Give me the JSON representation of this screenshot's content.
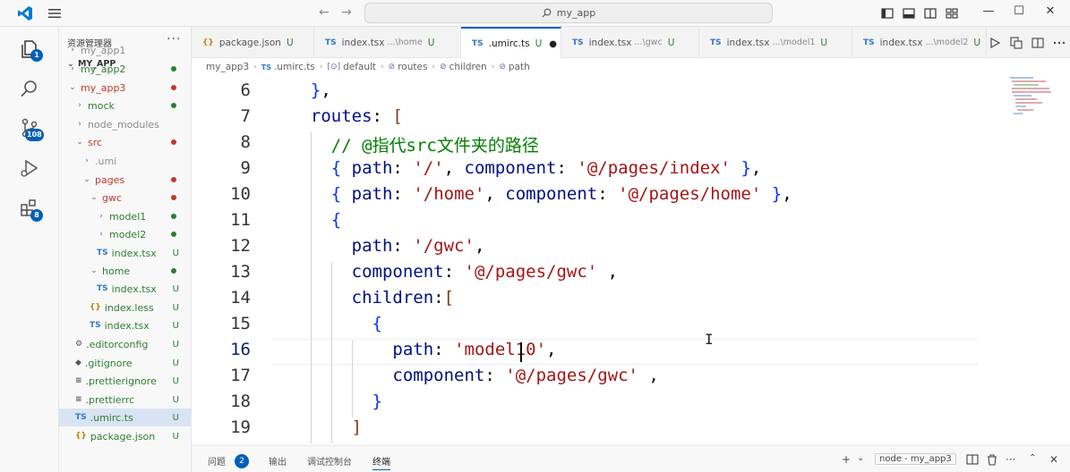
{
  "titlebar": {
    "search_text": "my_app",
    "back_icon": "arrow-left-icon",
    "forward_icon": "arrow-right-icon"
  },
  "activity": {
    "explorer_badge": "1",
    "scm_badge": "108",
    "extensions_badge": "8"
  },
  "sidebar": {
    "title": "资源管理器",
    "more": "···",
    "root_label": "MY_APP",
    "items": [
      {
        "label": "my_app1",
        "chevron": "›",
        "color": "grey",
        "status": ""
      },
      {
        "label": "my_app2",
        "chevron": "›",
        "color": "green",
        "status": "dot-green"
      },
      {
        "label": "my_app3",
        "chevron": "⌄",
        "color": "red",
        "status": "dot-red"
      },
      {
        "label": "mock",
        "chevron": "›",
        "color": "green",
        "status": "dot-green"
      },
      {
        "label": "node_modules",
        "chevron": "›",
        "color": "grey",
        "status": ""
      },
      {
        "label": "src",
        "chevron": "⌄",
        "color": "red",
        "status": "dot-red"
      },
      {
        "label": ".umi",
        "chevron": "›",
        "color": "grey",
        "status": ""
      },
      {
        "label": "pages",
        "chevron": "⌄",
        "color": "red",
        "status": "dot-red"
      },
      {
        "label": "gwc",
        "chevron": "⌄",
        "color": "red",
        "status": "dot-red"
      },
      {
        "label": "model1",
        "chevron": "›",
        "color": "green",
        "status": "dot-green"
      },
      {
        "label": "model2",
        "chevron": "›",
        "color": "green",
        "status": "dot-green"
      },
      {
        "label": "index.tsx",
        "icon": "TS",
        "color": "green",
        "status": "U"
      },
      {
        "label": "home",
        "chevron": "⌄",
        "color": "green",
        "status": "dot-green"
      },
      {
        "label": "index.tsx",
        "icon": "TS",
        "color": "green",
        "status": "U"
      },
      {
        "label": "index.less",
        "icon": "{}",
        "color": "green",
        "status": "U"
      },
      {
        "label": "index.tsx",
        "icon": "TS",
        "color": "green",
        "status": "U"
      },
      {
        "label": ".editorconfig",
        "icon": "⚙",
        "color": "green",
        "status": "U"
      },
      {
        "label": ".gitignore",
        "icon": "◆",
        "color": "green",
        "status": "U"
      },
      {
        "label": ".prettierignore",
        "icon": "≡",
        "color": "green",
        "status": "U"
      },
      {
        "label": ".prettierrc",
        "icon": "≡",
        "color": "green",
        "status": "U"
      },
      {
        "label": ".umirc.ts",
        "icon": "TS",
        "color": "green",
        "status": "U"
      },
      {
        "label": "package.json",
        "icon": "{}",
        "color": "green",
        "status": "U"
      }
    ]
  },
  "tabs": [
    {
      "icon": "{}",
      "name": "package.json",
      "desc": "",
      "status": "U",
      "active": false
    },
    {
      "icon": "TS",
      "name": "index.tsx",
      "desc": "...\\home",
      "status": "U",
      "active": false
    },
    {
      "icon": "TS",
      "name": ".umirc.ts",
      "desc": "",
      "status": "U",
      "active": true,
      "dirty": "●"
    },
    {
      "icon": "TS",
      "name": "index.tsx",
      "desc": "...\\gwc",
      "status": "U",
      "active": false
    },
    {
      "icon": "TS",
      "name": "index.tsx",
      "desc": "...\\model1",
      "status": "U",
      "active": false
    },
    {
      "icon": "TS",
      "name": "index.tsx",
      "desc": "...\\model2",
      "status": "U",
      "active": false
    }
  ],
  "breadcrumb": {
    "parts": [
      "my_app3",
      ".umirc.ts",
      "default",
      "routes",
      "children",
      "path"
    ],
    "icons": [
      "",
      "TS",
      "[⊙]",
      "⊘",
      "⊘",
      "⊘"
    ]
  },
  "editor": {
    "current_line": "16",
    "line_numbers": [
      "6",
      "7",
      "8",
      "9",
      "10",
      "11",
      "12",
      "13",
      "14",
      "15",
      "16",
      "17",
      "18",
      "19"
    ],
    "lines": [
      "  },",
      "  routes: [",
      "    // @指代src文件夹的路径",
      "    { path: '/', component: '@/pages/index' },",
      "    { path: '/home', component: '@/pages/home' },",
      "    {",
      "      path: '/gwc',",
      "      component: '@/pages/gwc' ,",
      "      children:[",
      "        {",
      "          path: 'model10',",
      "          component: '@/pages/gwc' ,",
      "        }",
      "      ]"
    ]
  },
  "panel": {
    "tabs": [
      "问题",
      "输出",
      "调试控制台",
      "终端"
    ],
    "problems_count": "2",
    "terminal_name": "node - my_app3",
    "actions": [
      "+",
      "⌄"
    ]
  },
  "colors": {
    "accent": "#005fb8",
    "git_untracked": "#2e7d32",
    "git_modified": "#c0392b",
    "string": "#a31515",
    "keyword_prop": "#001080",
    "comment": "#008000"
  }
}
